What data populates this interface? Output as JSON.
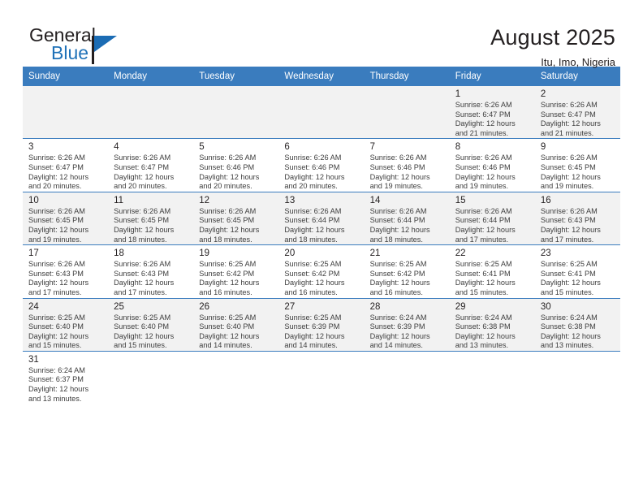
{
  "brand": {
    "name_part1": "General",
    "name_part2": "Blue",
    "flag_icon": "blue-flag-icon",
    "accent_color": "#2072b8"
  },
  "header": {
    "title": "August 2025",
    "subtitle": "Itu, Imo, Nigeria"
  },
  "theme": {
    "header_bg": "#3a7cbe",
    "header_text": "#ffffff",
    "band_bg": "#f2f2f2",
    "grid_line": "#3a7cbe"
  },
  "weekdays": [
    "Sunday",
    "Monday",
    "Tuesday",
    "Wednesday",
    "Thursday",
    "Friday",
    "Saturday"
  ],
  "labels": {
    "sunrise_prefix": "Sunrise:",
    "sunset_prefix": "Sunset:",
    "daylight_prefix": "Daylight:"
  },
  "weeks": [
    {
      "band": true,
      "days": [
        {
          "empty": true
        },
        {
          "empty": true
        },
        {
          "empty": true
        },
        {
          "empty": true
        },
        {
          "empty": true
        },
        {
          "date": "1",
          "sunrise": "Sunrise: 6:26 AM",
          "sunset": "Sunset: 6:47 PM",
          "daylight_line1": "Daylight: 12 hours",
          "daylight_line2": "and 21 minutes."
        },
        {
          "date": "2",
          "sunrise": "Sunrise: 6:26 AM",
          "sunset": "Sunset: 6:47 PM",
          "daylight_line1": "Daylight: 12 hours",
          "daylight_line2": "and 21 minutes."
        }
      ]
    },
    {
      "band": false,
      "days": [
        {
          "date": "3",
          "sunrise": "Sunrise: 6:26 AM",
          "sunset": "Sunset: 6:47 PM",
          "daylight_line1": "Daylight: 12 hours",
          "daylight_line2": "and 20 minutes."
        },
        {
          "date": "4",
          "sunrise": "Sunrise: 6:26 AM",
          "sunset": "Sunset: 6:47 PM",
          "daylight_line1": "Daylight: 12 hours",
          "daylight_line2": "and 20 minutes."
        },
        {
          "date": "5",
          "sunrise": "Sunrise: 6:26 AM",
          "sunset": "Sunset: 6:46 PM",
          "daylight_line1": "Daylight: 12 hours",
          "daylight_line2": "and 20 minutes."
        },
        {
          "date": "6",
          "sunrise": "Sunrise: 6:26 AM",
          "sunset": "Sunset: 6:46 PM",
          "daylight_line1": "Daylight: 12 hours",
          "daylight_line2": "and 20 minutes."
        },
        {
          "date": "7",
          "sunrise": "Sunrise: 6:26 AM",
          "sunset": "Sunset: 6:46 PM",
          "daylight_line1": "Daylight: 12 hours",
          "daylight_line2": "and 19 minutes."
        },
        {
          "date": "8",
          "sunrise": "Sunrise: 6:26 AM",
          "sunset": "Sunset: 6:46 PM",
          "daylight_line1": "Daylight: 12 hours",
          "daylight_line2": "and 19 minutes."
        },
        {
          "date": "9",
          "sunrise": "Sunrise: 6:26 AM",
          "sunset": "Sunset: 6:45 PM",
          "daylight_line1": "Daylight: 12 hours",
          "daylight_line2": "and 19 minutes."
        }
      ]
    },
    {
      "band": true,
      "days": [
        {
          "date": "10",
          "sunrise": "Sunrise: 6:26 AM",
          "sunset": "Sunset: 6:45 PM",
          "daylight_line1": "Daylight: 12 hours",
          "daylight_line2": "and 19 minutes."
        },
        {
          "date": "11",
          "sunrise": "Sunrise: 6:26 AM",
          "sunset": "Sunset: 6:45 PM",
          "daylight_line1": "Daylight: 12 hours",
          "daylight_line2": "and 18 minutes."
        },
        {
          "date": "12",
          "sunrise": "Sunrise: 6:26 AM",
          "sunset": "Sunset: 6:45 PM",
          "daylight_line1": "Daylight: 12 hours",
          "daylight_line2": "and 18 minutes."
        },
        {
          "date": "13",
          "sunrise": "Sunrise: 6:26 AM",
          "sunset": "Sunset: 6:44 PM",
          "daylight_line1": "Daylight: 12 hours",
          "daylight_line2": "and 18 minutes."
        },
        {
          "date": "14",
          "sunrise": "Sunrise: 6:26 AM",
          "sunset": "Sunset: 6:44 PM",
          "daylight_line1": "Daylight: 12 hours",
          "daylight_line2": "and 18 minutes."
        },
        {
          "date": "15",
          "sunrise": "Sunrise: 6:26 AM",
          "sunset": "Sunset: 6:44 PM",
          "daylight_line1": "Daylight: 12 hours",
          "daylight_line2": "and 17 minutes."
        },
        {
          "date": "16",
          "sunrise": "Sunrise: 6:26 AM",
          "sunset": "Sunset: 6:43 PM",
          "daylight_line1": "Daylight: 12 hours",
          "daylight_line2": "and 17 minutes."
        }
      ]
    },
    {
      "band": false,
      "days": [
        {
          "date": "17",
          "sunrise": "Sunrise: 6:26 AM",
          "sunset": "Sunset: 6:43 PM",
          "daylight_line1": "Daylight: 12 hours",
          "daylight_line2": "and 17 minutes."
        },
        {
          "date": "18",
          "sunrise": "Sunrise: 6:26 AM",
          "sunset": "Sunset: 6:43 PM",
          "daylight_line1": "Daylight: 12 hours",
          "daylight_line2": "and 17 minutes."
        },
        {
          "date": "19",
          "sunrise": "Sunrise: 6:25 AM",
          "sunset": "Sunset: 6:42 PM",
          "daylight_line1": "Daylight: 12 hours",
          "daylight_line2": "and 16 minutes."
        },
        {
          "date": "20",
          "sunrise": "Sunrise: 6:25 AM",
          "sunset": "Sunset: 6:42 PM",
          "daylight_line1": "Daylight: 12 hours",
          "daylight_line2": "and 16 minutes."
        },
        {
          "date": "21",
          "sunrise": "Sunrise: 6:25 AM",
          "sunset": "Sunset: 6:42 PM",
          "daylight_line1": "Daylight: 12 hours",
          "daylight_line2": "and 16 minutes."
        },
        {
          "date": "22",
          "sunrise": "Sunrise: 6:25 AM",
          "sunset": "Sunset: 6:41 PM",
          "daylight_line1": "Daylight: 12 hours",
          "daylight_line2": "and 15 minutes."
        },
        {
          "date": "23",
          "sunrise": "Sunrise: 6:25 AM",
          "sunset": "Sunset: 6:41 PM",
          "daylight_line1": "Daylight: 12 hours",
          "daylight_line2": "and 15 minutes."
        }
      ]
    },
    {
      "band": true,
      "days": [
        {
          "date": "24",
          "sunrise": "Sunrise: 6:25 AM",
          "sunset": "Sunset: 6:40 PM",
          "daylight_line1": "Daylight: 12 hours",
          "daylight_line2": "and 15 minutes."
        },
        {
          "date": "25",
          "sunrise": "Sunrise: 6:25 AM",
          "sunset": "Sunset: 6:40 PM",
          "daylight_line1": "Daylight: 12 hours",
          "daylight_line2": "and 15 minutes."
        },
        {
          "date": "26",
          "sunrise": "Sunrise: 6:25 AM",
          "sunset": "Sunset: 6:40 PM",
          "daylight_line1": "Daylight: 12 hours",
          "daylight_line2": "and 14 minutes."
        },
        {
          "date": "27",
          "sunrise": "Sunrise: 6:25 AM",
          "sunset": "Sunset: 6:39 PM",
          "daylight_line1": "Daylight: 12 hours",
          "daylight_line2": "and 14 minutes."
        },
        {
          "date": "28",
          "sunrise": "Sunrise: 6:24 AM",
          "sunset": "Sunset: 6:39 PM",
          "daylight_line1": "Daylight: 12 hours",
          "daylight_line2": "and 14 minutes."
        },
        {
          "date": "29",
          "sunrise": "Sunrise: 6:24 AM",
          "sunset": "Sunset: 6:38 PM",
          "daylight_line1": "Daylight: 12 hours",
          "daylight_line2": "and 13 minutes."
        },
        {
          "date": "30",
          "sunrise": "Sunrise: 6:24 AM",
          "sunset": "Sunset: 6:38 PM",
          "daylight_line1": "Daylight: 12 hours",
          "daylight_line2": "and 13 minutes."
        }
      ]
    },
    {
      "band": false,
      "days": [
        {
          "date": "31",
          "sunrise": "Sunrise: 6:24 AM",
          "sunset": "Sunset: 6:37 PM",
          "daylight_line1": "Daylight: 12 hours",
          "daylight_line2": "and 13 minutes."
        },
        {
          "empty": true
        },
        {
          "empty": true
        },
        {
          "empty": true
        },
        {
          "empty": true
        },
        {
          "empty": true
        },
        {
          "empty": true
        }
      ]
    }
  ]
}
